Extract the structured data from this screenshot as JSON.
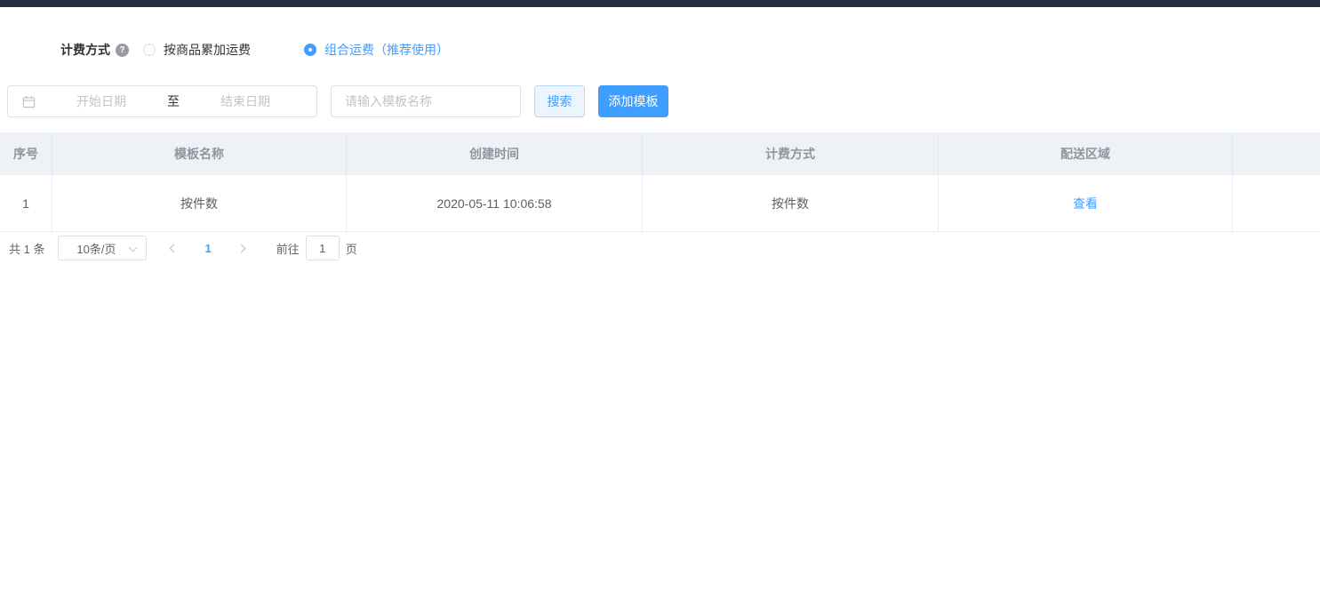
{
  "billing": {
    "label": "计费方式",
    "options": [
      {
        "label": "按商品累加运费",
        "selected": false
      },
      {
        "label": "组合运费（推荐使用）",
        "selected": true
      }
    ]
  },
  "filters": {
    "date_start_placeholder": "开始日期",
    "date_separator": "至",
    "date_end_placeholder": "结束日期",
    "name_placeholder": "请输入模板名称",
    "search_label": "搜索",
    "add_label": "添加模板"
  },
  "table": {
    "headers": [
      "序号",
      "模板名称",
      "创建时间",
      "计费方式",
      "配送区域",
      ""
    ],
    "rows": [
      {
        "index": "1",
        "name": "按件数",
        "created": "2020-05-11 10:06:58",
        "billing": "按件数",
        "region_link": "查看"
      }
    ]
  },
  "pagination": {
    "total": "共 1 条",
    "page_size": "10条/页",
    "current_page": "1",
    "goto_label": "前往",
    "goto_value": "1",
    "page_suffix": "页"
  },
  "colors": {
    "primary": "#409eff",
    "topbar": "#252d43",
    "table_header_bg": "#eef1f6",
    "search_button_bg": "#ecf5ff",
    "search_button_border": "#b3d8ff"
  }
}
